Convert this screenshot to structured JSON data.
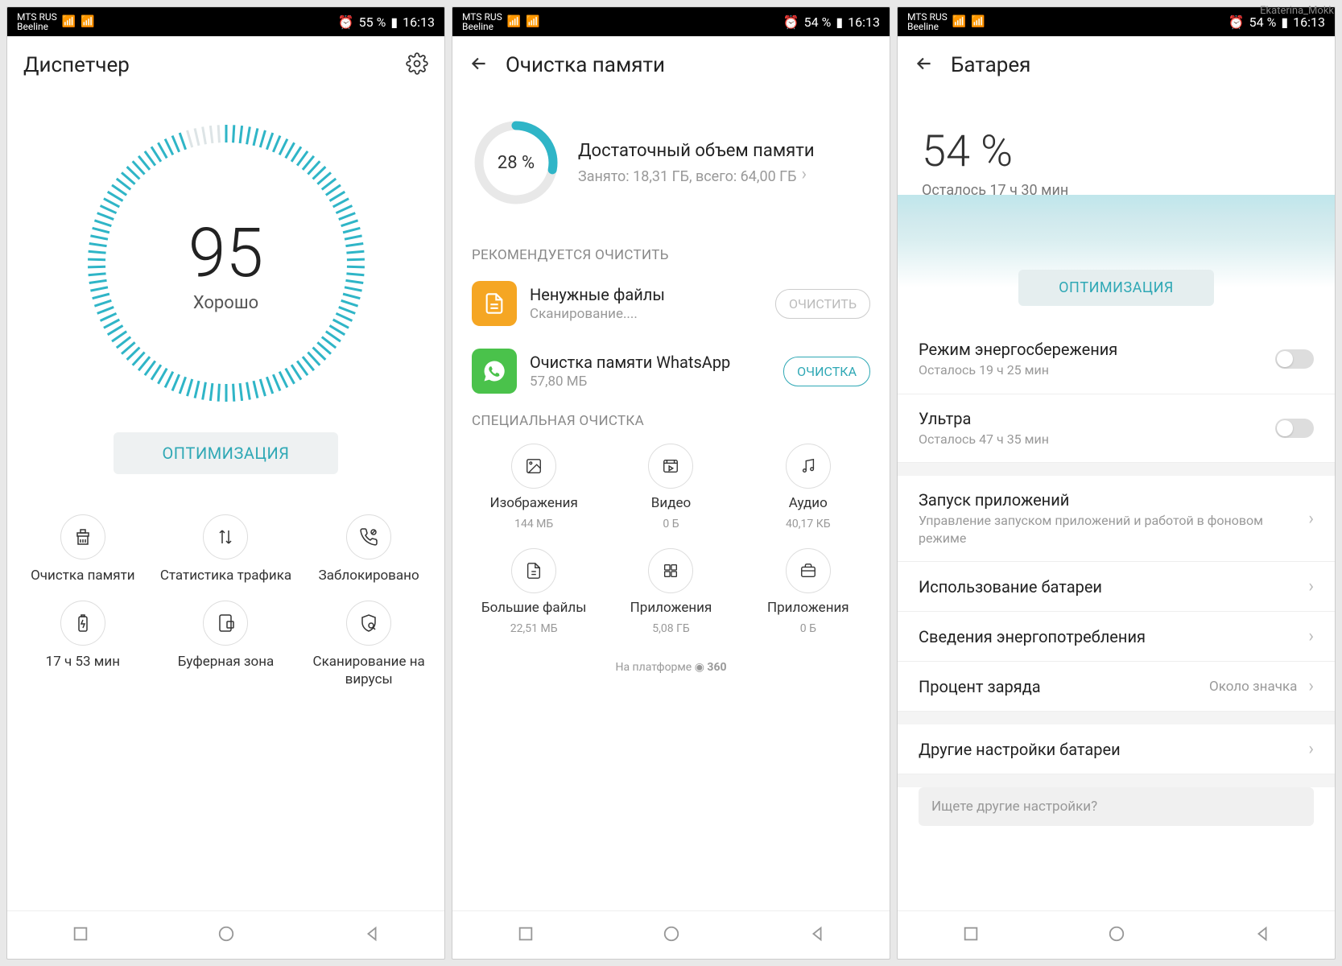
{
  "watermark": "Ekaterina_Mokk",
  "statusbar": {
    "carrier1": "MTS RUS",
    "carrier2": "Beeline",
    "battery1": "55 %",
    "battery2": "54 %",
    "battery3": "54 %",
    "time": "16:13"
  },
  "s1": {
    "title": "Диспетчер",
    "score": "95",
    "score_label": "Хорошо",
    "optimize": "ОПТИМИЗАЦИЯ",
    "tiles": [
      {
        "label": "Очистка памяти"
      },
      {
        "label": "Статистика трафика"
      },
      {
        "label": "Заблокировано"
      },
      {
        "label": "17 ч 53 мин"
      },
      {
        "label": "Буферная зона"
      },
      {
        "label": "Сканирование на вирусы"
      }
    ]
  },
  "s2": {
    "title": "Очистка памяти",
    "mem_pct": "28 %",
    "mem_title": "Достаточный объем памяти",
    "mem_sub": "Занято: 18,31 ГБ, всего: 64,00 ГБ",
    "sect_rec": "РЕКОМЕНДУЕТСЯ ОЧИСТИТЬ",
    "junk": {
      "title": "Ненужные файлы",
      "sub": "Сканирование....",
      "btn": "ОЧИСТИТЬ"
    },
    "wa": {
      "title": "Очистка памяти WhatsApp",
      "sub": "57,80 МБ",
      "btn": "ОЧИСТКА"
    },
    "sect_spec": "СПЕЦИАЛЬНАЯ ОЧИСТКА",
    "ctiles": [
      {
        "label": "Изображения",
        "size": "144 МБ"
      },
      {
        "label": "Видео",
        "size": "0 Б"
      },
      {
        "label": "Аудио",
        "size": "40,17 КБ"
      },
      {
        "label": "Большие файлы",
        "size": "22,51 МБ"
      },
      {
        "label": "Приложения",
        "size": "5,08 ГБ"
      },
      {
        "label": "Приложения",
        "size": "0 Б"
      }
    ],
    "powered": "На платформе",
    "powered_brand": "360"
  },
  "s3": {
    "title": "Батарея",
    "pct": "54 %",
    "remaining": "Осталось 17 ч 30 мин",
    "optimize": "ОПТИМИЗАЦИЯ",
    "rows": {
      "ps": {
        "title": "Режим энергосбережения",
        "sub": "Осталось 19 ч 25 мин"
      },
      "ultra": {
        "title": "Ультра",
        "sub": "Осталось 47 ч 35 мин"
      },
      "launch": {
        "title": "Запуск приложений",
        "sub": "Управление запуском приложений и работой в фоновом режиме"
      },
      "usage": {
        "title": "Использование батареи"
      },
      "details": {
        "title": "Сведения энергопотребления"
      },
      "percent": {
        "title": "Процент заряда",
        "val": "Около значка"
      },
      "other": {
        "title": "Другие настройки батареи"
      }
    },
    "search": "Ищете другие настройки?"
  }
}
